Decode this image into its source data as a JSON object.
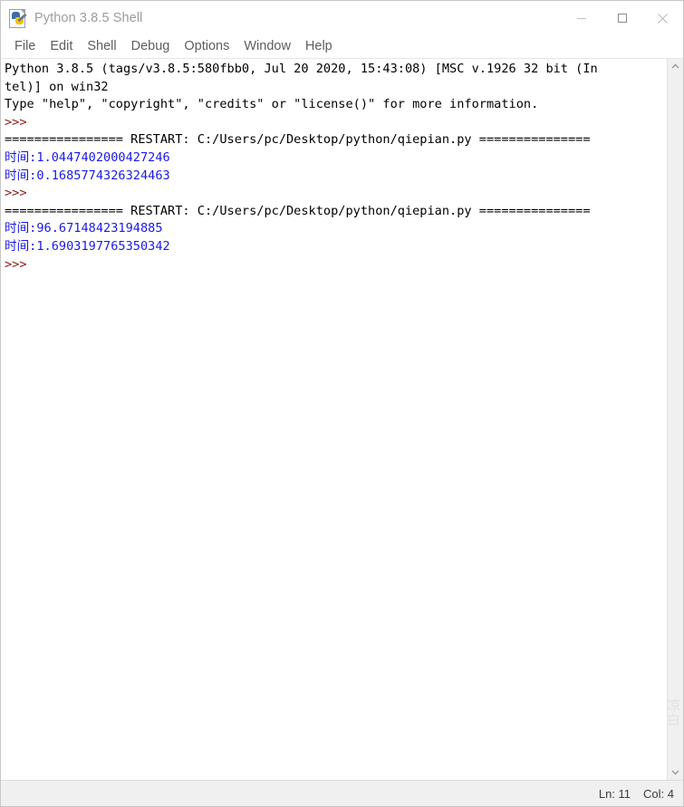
{
  "window": {
    "title": "Python 3.8.5 Shell",
    "icon": "python-idle-icon",
    "controls": {
      "minimize_label": "Minimize",
      "maximize_label": "Maximize",
      "close_label": "Close"
    }
  },
  "menubar": {
    "items": [
      {
        "label": "File"
      },
      {
        "label": "Edit"
      },
      {
        "label": "Shell"
      },
      {
        "label": "Debug"
      },
      {
        "label": "Options"
      },
      {
        "label": "Window"
      },
      {
        "label": "Help"
      }
    ]
  },
  "console": {
    "lines": [
      {
        "text": "Python 3.8.5 (tags/v3.8.5:580fbb0, Jul 20 2020, 15:43:08) [MSC v.1926 32 bit (In",
        "style": "std"
      },
      {
        "text": "tel)] on win32",
        "style": "std"
      },
      {
        "text": "Type \"help\", \"copyright\", \"credits\" or \"license()\" for more information.",
        "style": "std"
      },
      {
        "text": ">>> ",
        "style": "prompt"
      },
      {
        "text": "================ RESTART: C:/Users/pc/Desktop/python/qiepian.py ===============",
        "style": "restart"
      },
      {
        "text": "时间:1.0447402000427246",
        "style": "out"
      },
      {
        "text": "时间:0.1685774326324463",
        "style": "out"
      },
      {
        "text": ">>> ",
        "style": "prompt"
      },
      {
        "text": "================ RESTART: C:/Users/pc/Desktop/python/qiepian.py ===============",
        "style": "restart"
      },
      {
        "text": "时间:96.67148423194885",
        "style": "out"
      },
      {
        "text": "时间:1.6903197765350342",
        "style": "out"
      },
      {
        "text": ">>> ",
        "style": "prompt"
      }
    ],
    "colors": {
      "stdout_blue": "#1a1ae6",
      "prompt_red": "#8b1a1a",
      "text_black": "#000000",
      "background": "#ffffff"
    }
  },
  "scrollbar": {
    "up_arrow": "chevron-up-icon",
    "down_arrow": "chevron-down-icon"
  },
  "watermark": {
    "text": "凉白"
  },
  "statusbar": {
    "line": "Ln: 11",
    "col": "Col: 4"
  }
}
